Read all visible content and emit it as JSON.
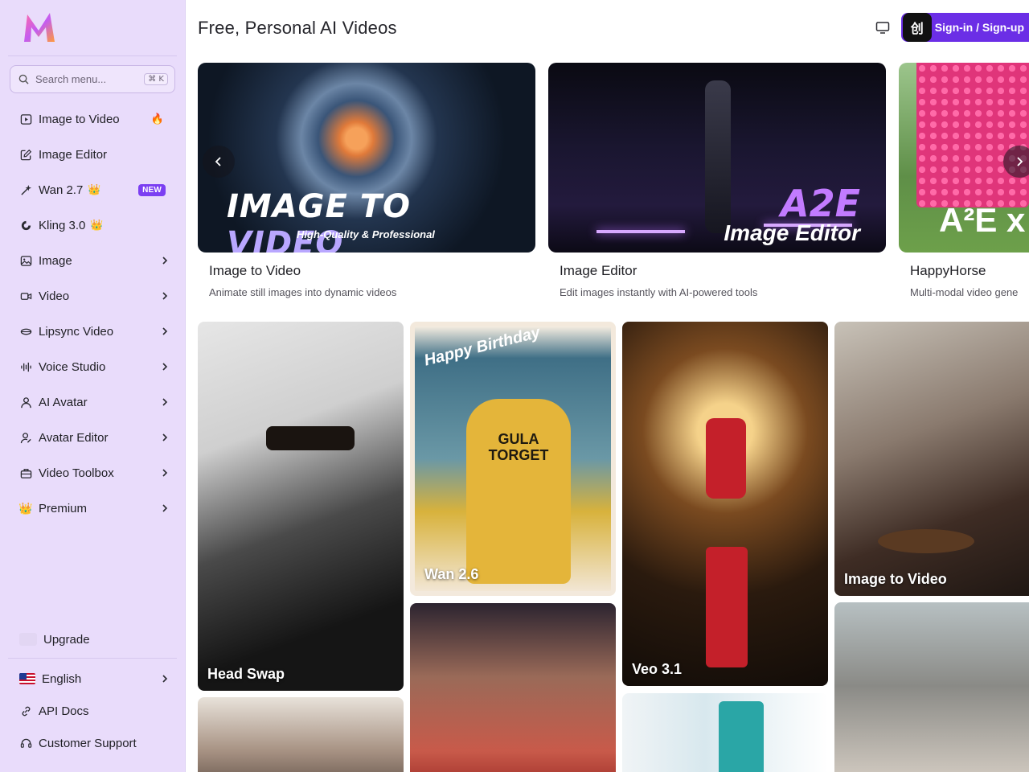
{
  "sidebar": {
    "logo_letter": "M",
    "search": {
      "placeholder": "Search menu...",
      "shortcut": "⌘ K"
    },
    "items": [
      {
        "label": "Image to Video",
        "icon": "play-square-icon",
        "badge": "🔥"
      },
      {
        "label": "Image Editor",
        "icon": "edit-square-icon"
      },
      {
        "label": "Wan 2.7",
        "icon": "sparkle-wand-icon",
        "crown": "👑",
        "badge": "NEW"
      },
      {
        "label": "Kling 3.0",
        "icon": "kling-swirl-icon",
        "crown": "👑"
      },
      {
        "label": "Image",
        "icon": "image-icon"
      },
      {
        "label": "Video",
        "icon": "video-camera-icon"
      },
      {
        "label": "Lipsync Video",
        "icon": "lips-icon"
      },
      {
        "label": "Voice Studio",
        "icon": "waveform-icon"
      },
      {
        "label": "AI Avatar",
        "icon": "user-icon"
      },
      {
        "label": "Avatar Editor",
        "icon": "user-edit-icon"
      },
      {
        "label": "Video Toolbox",
        "icon": "toolbox-icon"
      },
      {
        "label": "Premium",
        "icon": "crown-icon"
      }
    ],
    "upgrade_label": "Upgrade",
    "bottom_items": [
      {
        "label": "English",
        "icon": "us-flag-icon"
      },
      {
        "label": "API Docs",
        "icon": "link-icon"
      },
      {
        "label": "Customer Support",
        "icon": "headset-icon"
      }
    ]
  },
  "header": {
    "title": "Free, Personal AI Videos",
    "signin_label": "Sign-in / Sign-up",
    "app_badge": "创"
  },
  "featured": [
    {
      "title": "Image to Video",
      "desc": "Animate still images into dynamic videos",
      "overlay_main": "IMAGE TO ",
      "overlay_accent": "VIDEO",
      "overlay_sub": "High-Quality & Professional"
    },
    {
      "title": "Image Editor",
      "desc": "Edit images instantly with AI-powered tools",
      "overlay_main": "A2E",
      "overlay_sub": "Image Editor"
    },
    {
      "title": "HappyHorse",
      "desc": "Multi-modal video gene",
      "overlay_main": "A²E x"
    }
  ],
  "gallery": [
    {
      "label": "Head Swap"
    },
    {
      "label": "Wan 2.6",
      "sticker": "Happy Birthday",
      "shirt": "GULA TORGET"
    },
    {
      "label": "Veo 3.1"
    },
    {
      "label": "Image to Video"
    },
    {
      "label": ""
    },
    {
      "label": ""
    },
    {
      "label": ""
    },
    {
      "label": ""
    }
  ],
  "colors": {
    "sidebar_bg": "#e9dcfb",
    "accent": "#6b2ee6",
    "badge_new": "#7b3ff2"
  }
}
